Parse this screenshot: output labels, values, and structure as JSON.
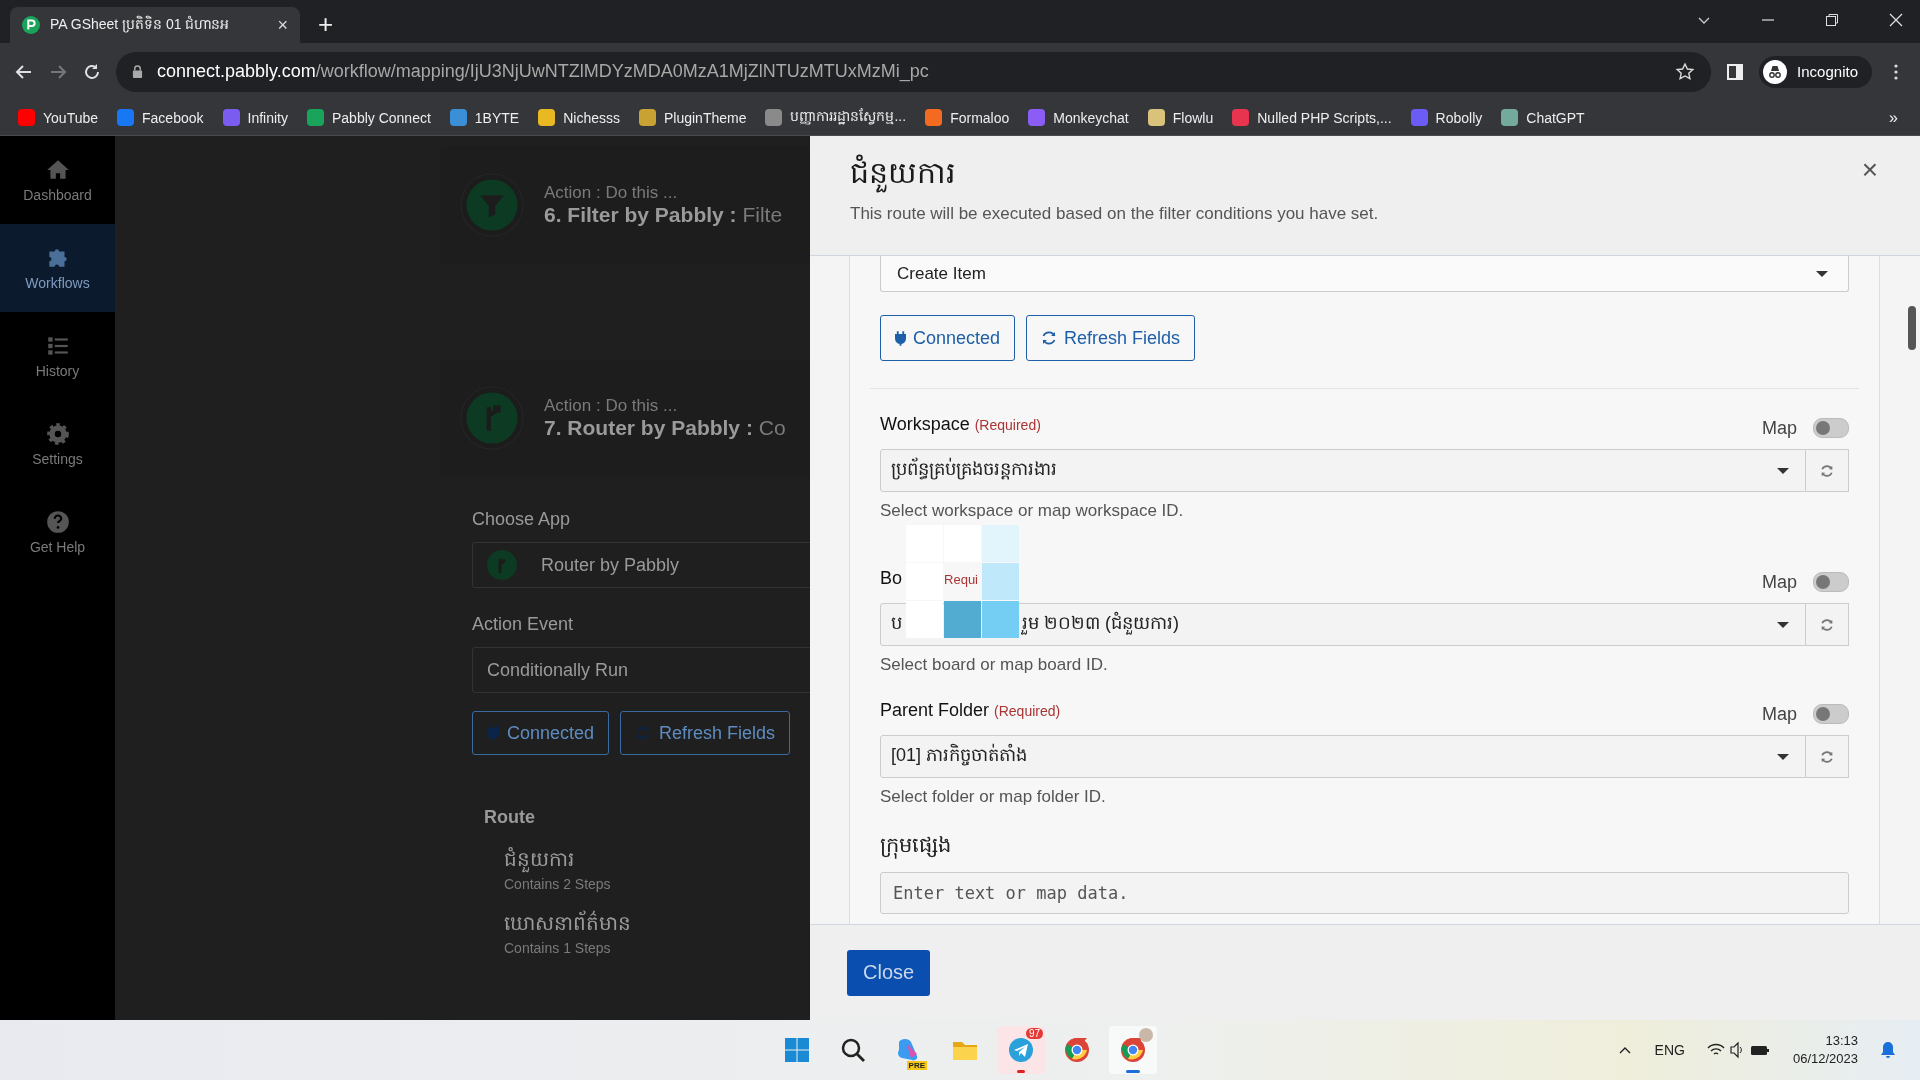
{
  "browser": {
    "tab": {
      "title": "PA GSheet ប្រតិទិន 01 ជំហានអ",
      "close": "×",
      "new_tab": "+"
    },
    "url": {
      "host": "connect.pabbly.com",
      "path": "/workflow/mapping/IjU3NjUwNTZlMDYzMDA0MzA1MjZlNTUzMTUxMzMi_pc"
    },
    "profile": "Incognito",
    "bookmarks": [
      {
        "label": "YouTube",
        "color": "#ff0000"
      },
      {
        "label": "Facebook",
        "color": "#1877f2"
      },
      {
        "label": "Infinity",
        "color": "#7b5cf0"
      },
      {
        "label": "Pabbly Connect",
        "color": "#1aa35a"
      },
      {
        "label": "1BYTE",
        "color": "#3a8fd6"
      },
      {
        "label": "Nichesss",
        "color": "#e8b923"
      },
      {
        "label": "PluginTheme",
        "color": "#c8a233"
      },
      {
        "label": "បញ្ញាការរដ្ឋានស្វែកម្ម...",
        "color": "#8a8a8a"
      },
      {
        "label": "Formaloo",
        "color": "#f26b21"
      },
      {
        "label": "Monkeychat",
        "color": "#8b5cf6"
      },
      {
        "label": "Flowlu",
        "color": "#d9c27a"
      },
      {
        "label": "Nulled PHP Scripts,...",
        "color": "#e8344e"
      },
      {
        "label": "Robolly",
        "color": "#6b5cf6"
      },
      {
        "label": "ChatGPT",
        "color": "#74aa9c"
      }
    ],
    "more": "»"
  },
  "sidebar": {
    "items": [
      {
        "label": "Dashboard",
        "kind": "home",
        "selected": false
      },
      {
        "label": "Workflows",
        "kind": "puzzle",
        "selected": true
      },
      {
        "label": "History",
        "kind": "list",
        "selected": false
      },
      {
        "label": "Settings",
        "kind": "gear",
        "selected": false
      },
      {
        "label": "Get Help",
        "kind": "help",
        "selected": false
      }
    ]
  },
  "workflow": {
    "steps": [
      {
        "kind": "filter",
        "caption": "Action : Do this ...",
        "title": "6. Filter by Pabbly :",
        "title_rest": "Filte"
      },
      {
        "kind": "router",
        "caption": "Action : Do this ...",
        "title": "7. Router by Pabbly :",
        "title_rest": "Co"
      }
    ],
    "choose_app": {
      "label": "Choose App",
      "value": "Router by Pabbly"
    },
    "action_event": {
      "label": "Action Event",
      "value": "Conditionally Run"
    },
    "buttons": [
      {
        "kind": "plug",
        "label": "Connected"
      },
      {
        "kind": "refresh",
        "label": "Refresh Fields"
      }
    ],
    "route": {
      "label": "Route",
      "items": [
        {
          "name": "ជំនួយការ",
          "steps": "Contains 2 Steps"
        },
        {
          "name": "ឃោសនាព័ត៌មាន",
          "steps": "Contains 1 Steps"
        }
      ]
    }
  },
  "modal": {
    "title": "ជំនួយការ",
    "subtitle": "This route will be executed based on the filter conditions you have set.",
    "close": "×",
    "event_value": "Create Item",
    "buttons": [
      {
        "kind": "plug",
        "label": "Connected"
      },
      {
        "kind": "refresh",
        "label": "Refresh Fields"
      }
    ],
    "fields": [
      {
        "kind": "select",
        "label": "Workspace",
        "required": "(Required)",
        "map_label": "Map",
        "map_on": false,
        "value": "ប្រព័ន្ធគ្រប់គ្រងចរន្តការងារ",
        "help": "Select workspace or map workspace ID."
      },
      {
        "kind": "obscured",
        "label": "Bo",
        "required": "Requi",
        "map_label": "Map",
        "map_on": false,
        "value": "ប",
        "value_rest": "រួម ២០២៣ (ជំនួយការ)",
        "help": "Select board or map board ID."
      },
      {
        "kind": "select",
        "label": "Parent Folder",
        "required": "(Required)",
        "map_label": "Map",
        "map_on": false,
        "value": "[01] ភារកិច្ចចាត់តាំង",
        "help": "Select folder or map folder ID."
      },
      {
        "kind": "text",
        "label": "ក្រុមផ្សេង",
        "placeholder": "Enter text or map data."
      }
    ],
    "close_button": "Close"
  },
  "taskbar": {
    "apps": [
      {
        "kind": "start",
        "running": false
      },
      {
        "kind": "search",
        "running": false
      },
      {
        "kind": "copilot",
        "running": false,
        "badge": "PRE"
      },
      {
        "kind": "folder",
        "running": false
      },
      {
        "kind": "telegram",
        "running": true,
        "badge": "97"
      },
      {
        "kind": "chrome",
        "running": false
      },
      {
        "kind": "chrome-profile",
        "running": true
      }
    ],
    "language": "ENG",
    "time": "13:13",
    "date": "06/12/2023"
  }
}
